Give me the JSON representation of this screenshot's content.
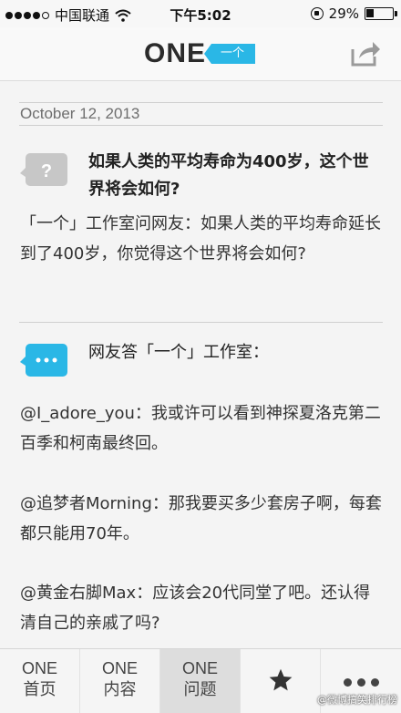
{
  "status_bar": {
    "carrier": "中国联通",
    "time": "下午5:02",
    "battery": "29%",
    "battery_level": 0.29
  },
  "header": {
    "logo_text": "ONE",
    "logo_badge": "一个",
    "share_icon": "share-icon"
  },
  "content": {
    "date": "October 12, 2013",
    "question_title": "如果人类的平均寿命为400岁，这个世界将会如何?",
    "question_body": "「一个」工作室问网友：如果人类的平均寿命延长到了400岁，你觉得这个世界将会如何?",
    "answers_heading": "网友答「一个」工作室：",
    "answers": [
      "@I_adore_you：我或许可以看到神探夏洛克第二百季和柯南最终回。",
      "@追梦者Morning：那我要买多少套房子啊，每套都只能用70年。",
      "@黄金右脚Max：应该会20代同堂了吧。还认得清自己的亲戚了吗?"
    ]
  },
  "tabbar": {
    "tabs": [
      {
        "top": "ONE",
        "bottom": "首页"
      },
      {
        "top": "ONE",
        "bottom": "内容"
      },
      {
        "top": "ONE",
        "bottom": "问题"
      }
    ],
    "active_index": 2,
    "favorites_icon": "star-icon",
    "more_icon": "more-dots-icon"
  },
  "watermark": "@微博搞笑排行榜",
  "colors": {
    "accent": "#2ab7e6",
    "question_icon": "#c7c7c7"
  }
}
